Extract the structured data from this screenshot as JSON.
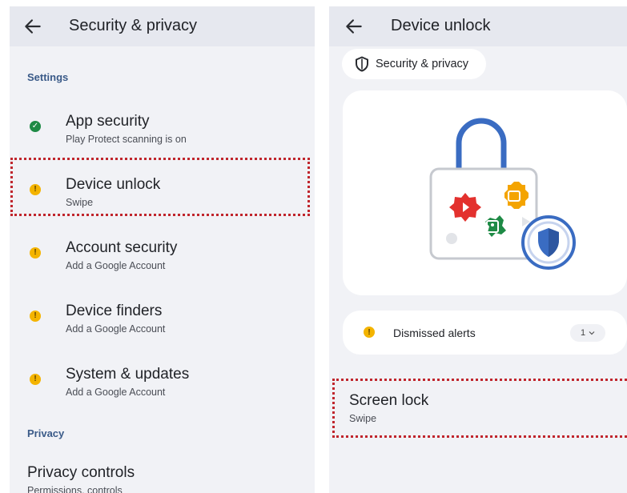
{
  "left": {
    "title": "Security & privacy",
    "sections": {
      "settings": "Settings",
      "privacy": "Privacy"
    },
    "items": [
      {
        "title": "App security",
        "subtitle": "Play Protect scanning is on",
        "status": "ok"
      },
      {
        "title": "Device unlock",
        "subtitle": "Swipe",
        "status": "warning"
      },
      {
        "title": "Account security",
        "subtitle": "Add a Google Account",
        "status": "warning"
      },
      {
        "title": "Device finders",
        "subtitle": "Add a Google Account",
        "status": "warning"
      },
      {
        "title": "System & updates",
        "subtitle": "Add a Google Account",
        "status": "warning"
      }
    ],
    "privacy_item": {
      "title": "Privacy controls",
      "subtitle": "Permissions, controls"
    }
  },
  "right": {
    "title": "Device unlock",
    "breadcrumb_chip": "Security & privacy",
    "alerts": {
      "label": "Dismissed alerts",
      "count": "1"
    },
    "screen_lock": {
      "title": "Screen lock",
      "subtitle": "Swipe"
    }
  },
  "icons": {
    "back": "arrow-left-icon",
    "ok": "check-circle-icon",
    "warning": "exclamation-circle-icon",
    "shield": "shield-icon",
    "chevron": "chevron-down-icon"
  },
  "colors": {
    "panel_bg": "#f1f2f6",
    "appbar_bg": "#e6e8ef",
    "section_header": "#3a5a88",
    "ok_green": "#1e8a45",
    "warning_yellow": "#f4b400",
    "highlight_red": "#c0262d",
    "lock_blue": "#3a6cc2"
  }
}
